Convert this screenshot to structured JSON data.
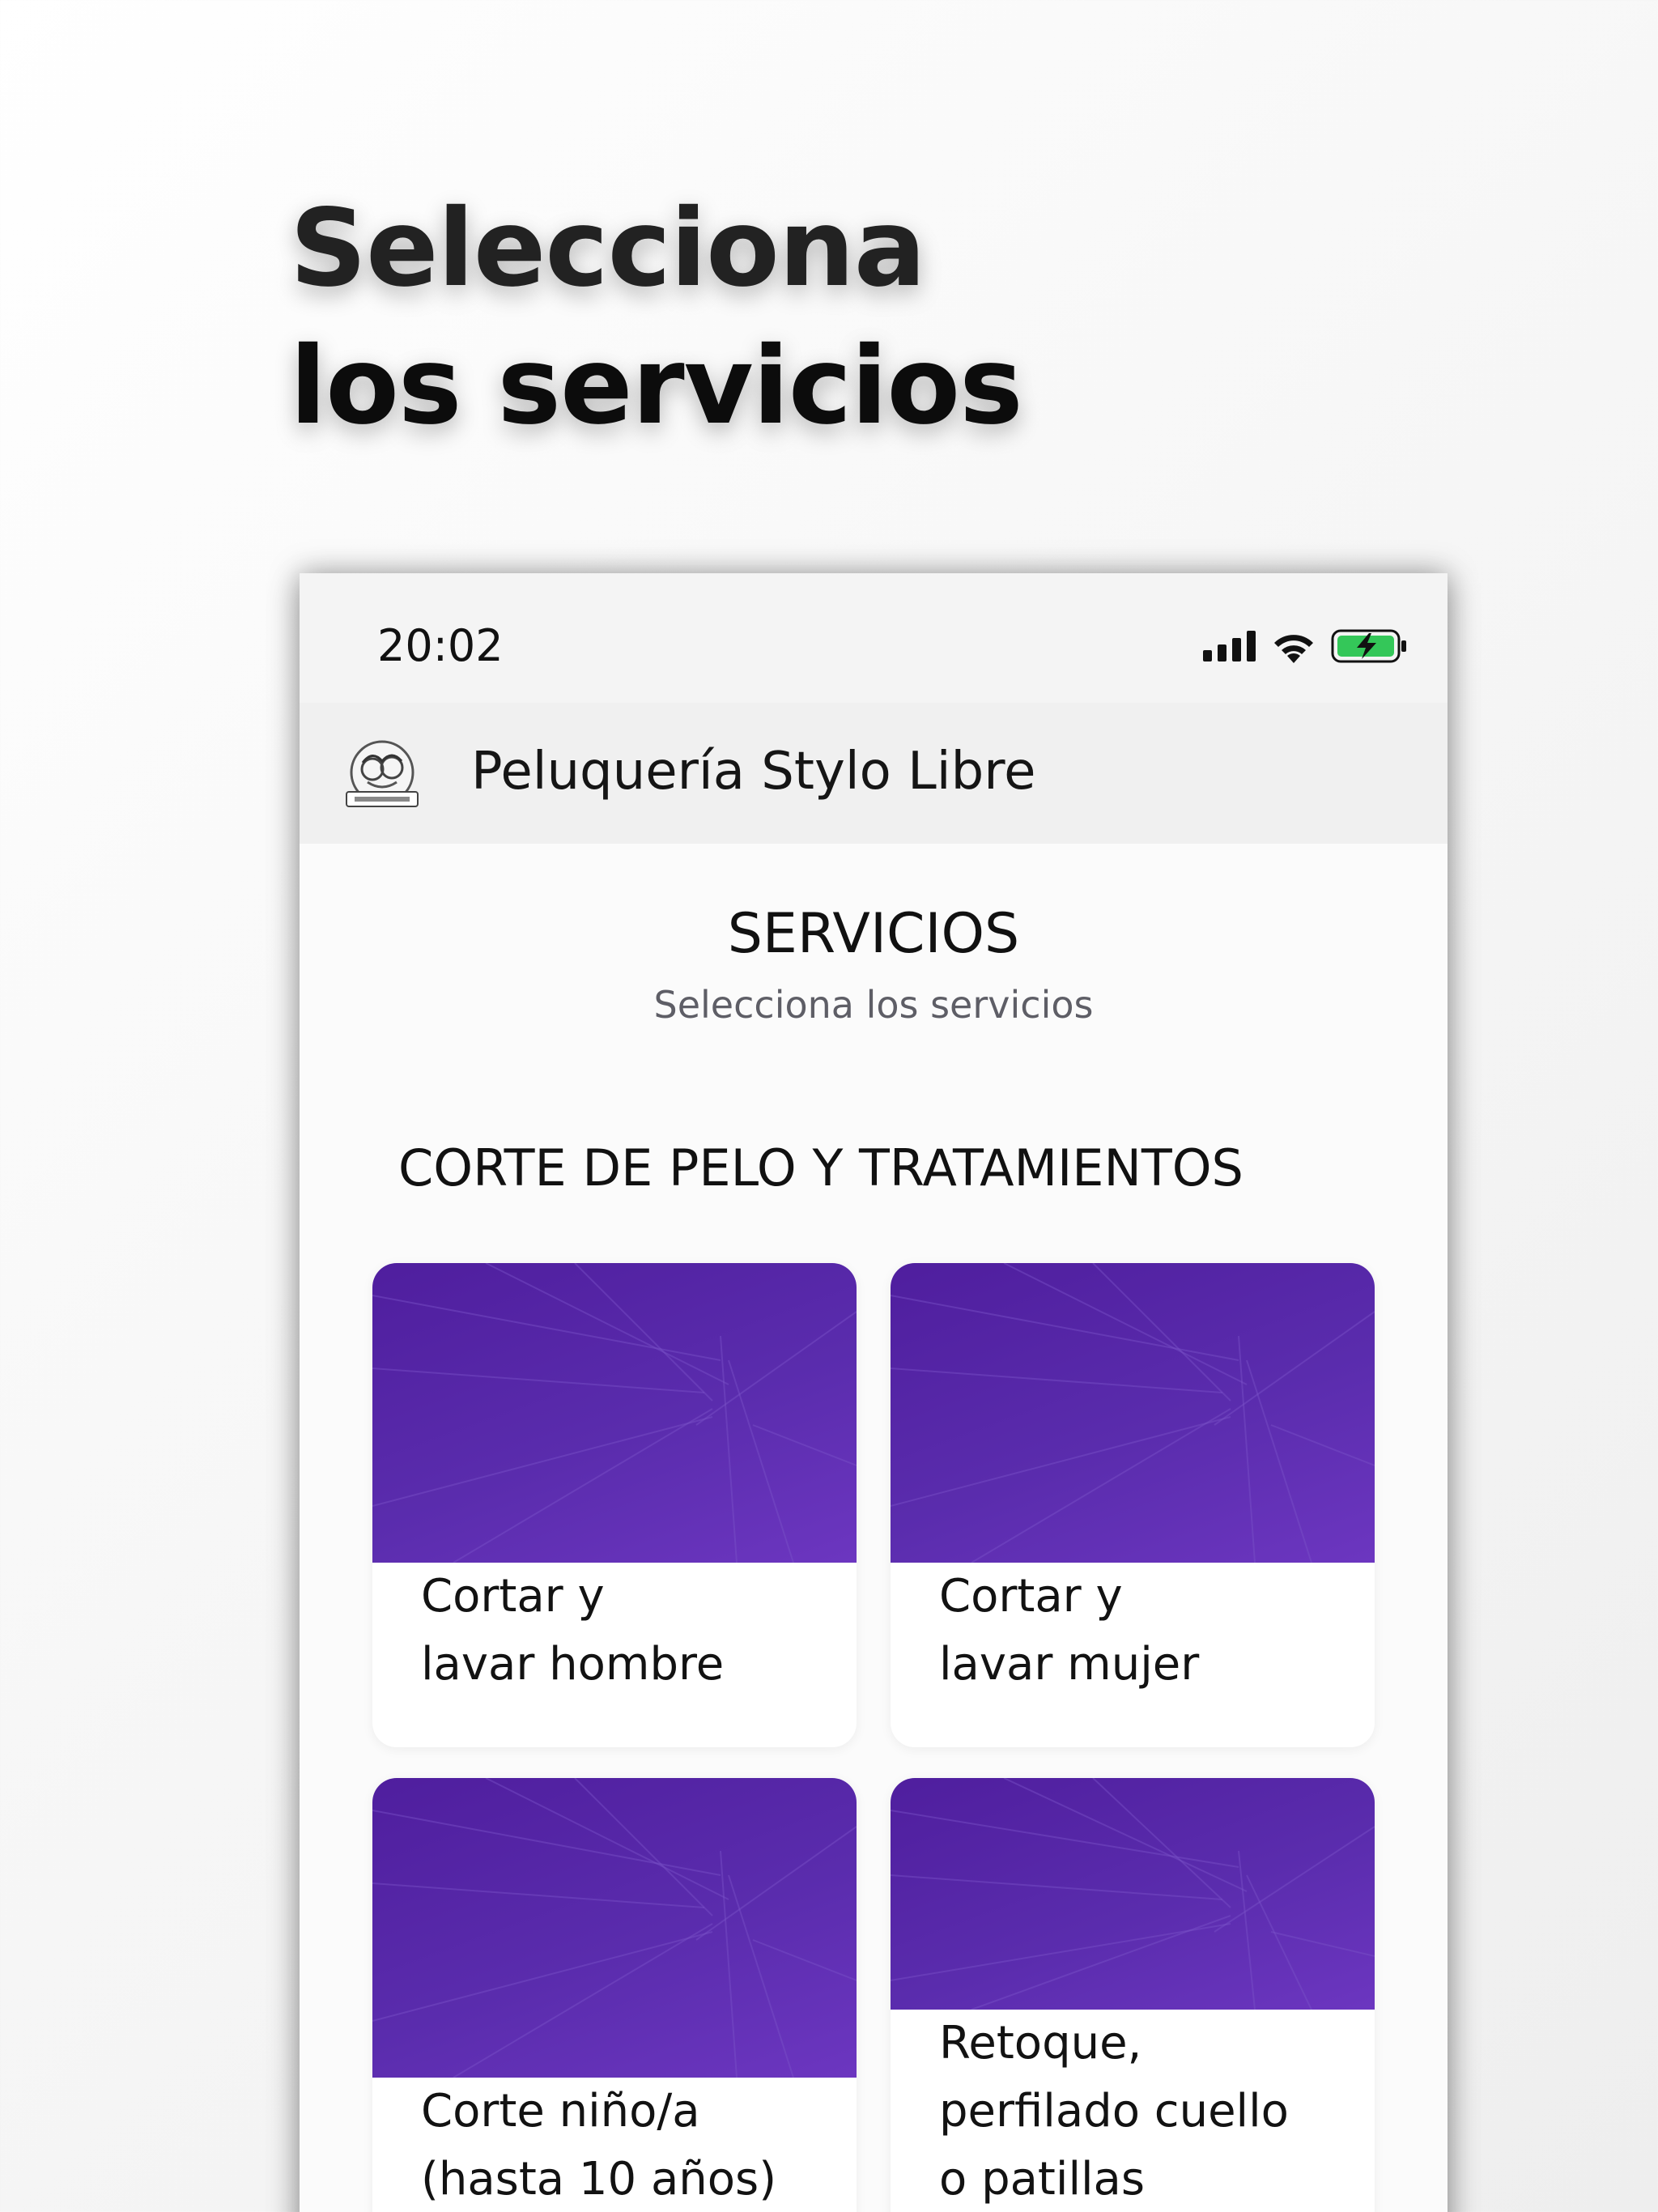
{
  "headline": {
    "line1": "Selecciona",
    "line2": "los servicios"
  },
  "status_bar": {
    "time": "20:02",
    "icons": [
      "signal-icon",
      "wifi-icon",
      "battery-charging-icon"
    ]
  },
  "app_bar": {
    "title": "Peluquería Stylo Libre",
    "logo": "stylo-libre-logo"
  },
  "main": {
    "title": "SERVICIOS",
    "subtitle": "Selecciona los servicios",
    "category": "CORTE DE PELO Y TRATAMIENTOS",
    "services": [
      {
        "line1": "Cortar y",
        "line2": "lavar hombre",
        "line3": ""
      },
      {
        "line1": "Cortar y",
        "line2": "lavar mujer",
        "line3": ""
      },
      {
        "line1": "Corte niño/a",
        "line2": "(hasta 10 años)",
        "line3": ""
      },
      {
        "line1": "Retoque,",
        "line2": "perfilado cuello",
        "line3": "o patillas"
      }
    ]
  },
  "colors": {
    "accent_purple": "#5a2cad",
    "battery_green": "#34c759"
  }
}
